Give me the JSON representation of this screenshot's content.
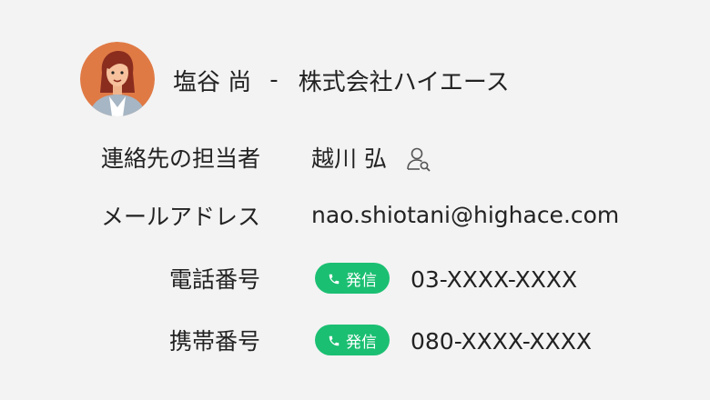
{
  "header": {
    "name": "塩谷 尚",
    "separator": "-",
    "company": "株式会社ハイエース"
  },
  "fields": {
    "contact_person": {
      "label": "連絡先の担当者",
      "value": "越川 弘"
    },
    "email": {
      "label": "メールアドレス",
      "value": "nao.shiotani@highace.com"
    },
    "phone": {
      "label": "電話番号",
      "call_label": "発信",
      "value": "03-XXXX-XXXX"
    },
    "mobile": {
      "label": "携帯番号",
      "call_label": "発信",
      "value": "080-XXXX-XXXX"
    }
  },
  "icons": {
    "avatar": "avatar-woman",
    "contact_person": "person-search-icon",
    "call": "phone-icon"
  },
  "colors": {
    "background": "#f3f3f3",
    "call_button": "#1bbf72",
    "avatar_bg": "#e07a45"
  }
}
